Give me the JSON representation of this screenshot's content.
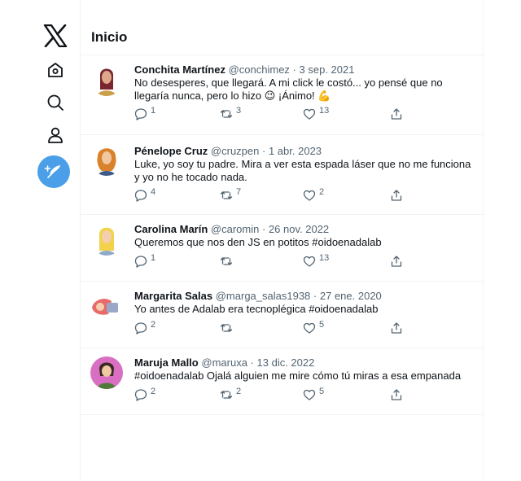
{
  "header": {
    "title": "Inicio"
  },
  "nav": {
    "logo_icon": "x-logo-icon",
    "items": [
      "home-icon",
      "search-icon",
      "profile-icon"
    ],
    "compose_icon": "feather-icon",
    "compose_color": "#4a9fe8"
  },
  "tweets": [
    {
      "name": "Conchita Martínez",
      "handle": "@conchimez",
      "sep": "·",
      "date": "3 sep. 2021",
      "text": "No desesperes, que llegará. A mi click le costó... yo pensé que no llegaría nunca, pero lo hizo 😉 ¡Ánimo! 💪",
      "replies": "1",
      "retweets": "3",
      "likes": "13"
    },
    {
      "name": "Pénelope Cruz",
      "handle": "@cruzpen",
      "sep": "·",
      "date": "1 abr. 2023",
      "text": "Luke, yo soy tu padre. Mira a ver esta espada láser que no me funciona y yo no he tocado nada.",
      "replies": "4",
      "retweets": "7",
      "likes": "2"
    },
    {
      "name": "Carolina Marín",
      "handle": "@caromin",
      "sep": "·",
      "date": "26 nov. 2022",
      "text": "Queremos que nos den JS en potitos #oidoenadalab",
      "replies": "1",
      "retweets": "",
      "likes": "13"
    },
    {
      "name": "Margarita Salas",
      "handle": "@marga_salas1938",
      "sep": "·",
      "date": "27 ene. 2020",
      "text": "Yo antes de Adalab era tecnoplégica #oidoenadalab",
      "replies": "2",
      "retweets": "",
      "likes": "5"
    },
    {
      "name": "Maruja Mallo",
      "handle": "@maruxa",
      "sep": "·",
      "date": "13 dic. 2022",
      "text": "#oidoenadalab Ojalá alguien me mire cómo tú miras a esa empanada",
      "replies": "2",
      "retweets": "2",
      "likes": "5"
    }
  ]
}
